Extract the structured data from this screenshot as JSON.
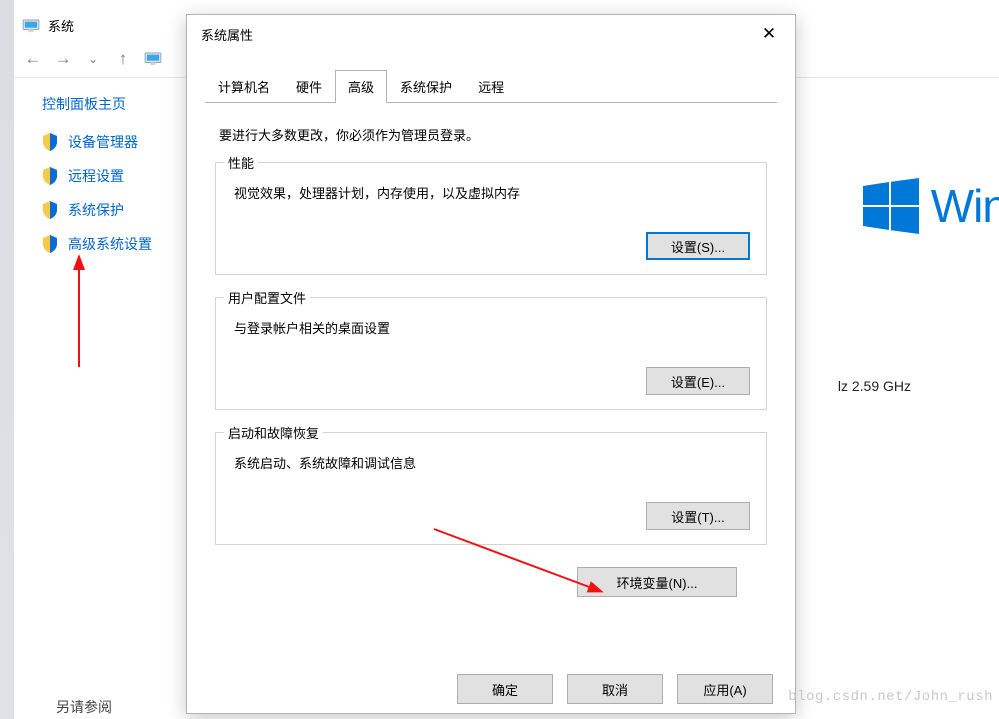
{
  "explorer": {
    "title": "系统",
    "cp_home": "控制面板主页",
    "side_items": [
      "设备管理器",
      "远程设置",
      "系统保护",
      "高级系统设置"
    ],
    "see_also": "另请参阅"
  },
  "background": {
    "win_text": "Winc",
    "ghz_text": "lz   2.59 GHz"
  },
  "dialog": {
    "title": "系统属性",
    "tabs": [
      "计算机名",
      "硬件",
      "高级",
      "系统保护",
      "远程"
    ],
    "active_tab_index": 2,
    "admin_note": "要进行大多数更改，你必须作为管理员登录。",
    "groups": {
      "performance": {
        "legend": "性能",
        "desc": "视觉效果，处理器计划，内存使用，以及虚拟内存",
        "button": "设置(S)..."
      },
      "userprofile": {
        "legend": "用户配置文件",
        "desc": "与登录帐户相关的桌面设置",
        "button": "设置(E)..."
      },
      "startup": {
        "legend": "启动和故障恢复",
        "desc": "系统启动、系统故障和调试信息",
        "button": "设置(T)..."
      }
    },
    "env_button": "环境变量(N)...",
    "footer": {
      "ok": "确定",
      "cancel": "取消",
      "apply": "应用(A)"
    }
  },
  "watermark": "blog.csdn.net/John_rush"
}
